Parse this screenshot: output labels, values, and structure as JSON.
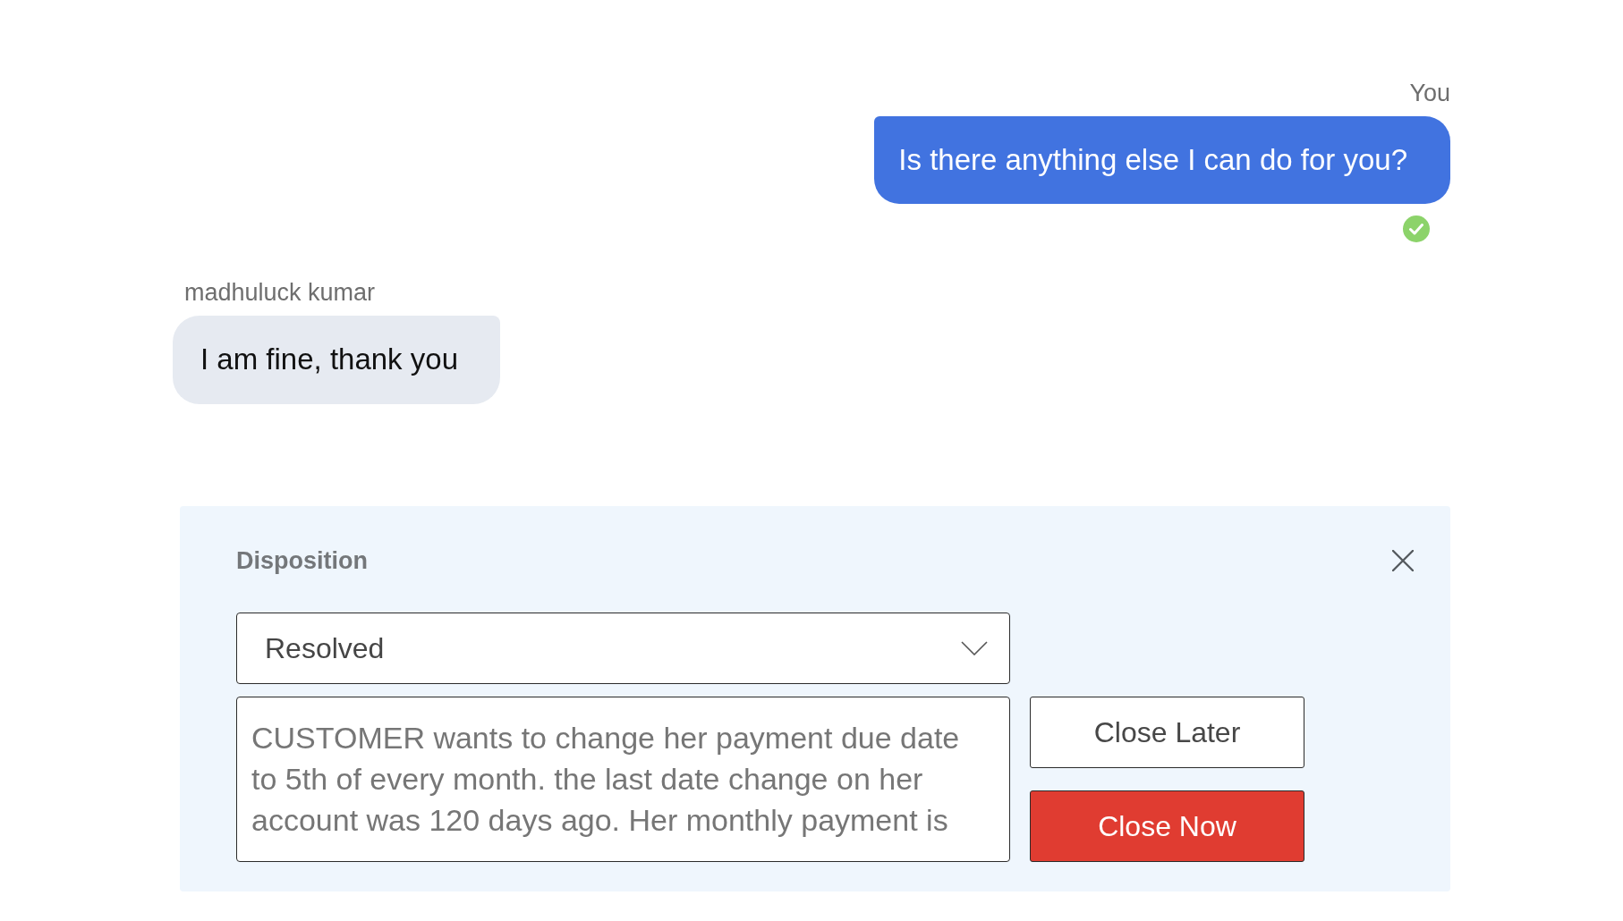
{
  "messages": [
    {
      "kind": "outgoing",
      "sender": "You",
      "text": "Is there anything else I can do for you?",
      "delivered": true
    },
    {
      "kind": "incoming",
      "sender": "madhuluck kumar",
      "text": "I am fine, thank you"
    }
  ],
  "disposition": {
    "title": "Disposition",
    "select": {
      "value": "Resolved"
    },
    "notes": {
      "value": "CUSTOMER wants to change her payment due date to 5th of every month. the last date change on her account was 120 days ago. Her monthly payment is"
    },
    "buttons": [
      {
        "label": "Close Later",
        "kind": "secondary"
      },
      {
        "label": "Close Now",
        "kind": "primary"
      }
    ]
  }
}
